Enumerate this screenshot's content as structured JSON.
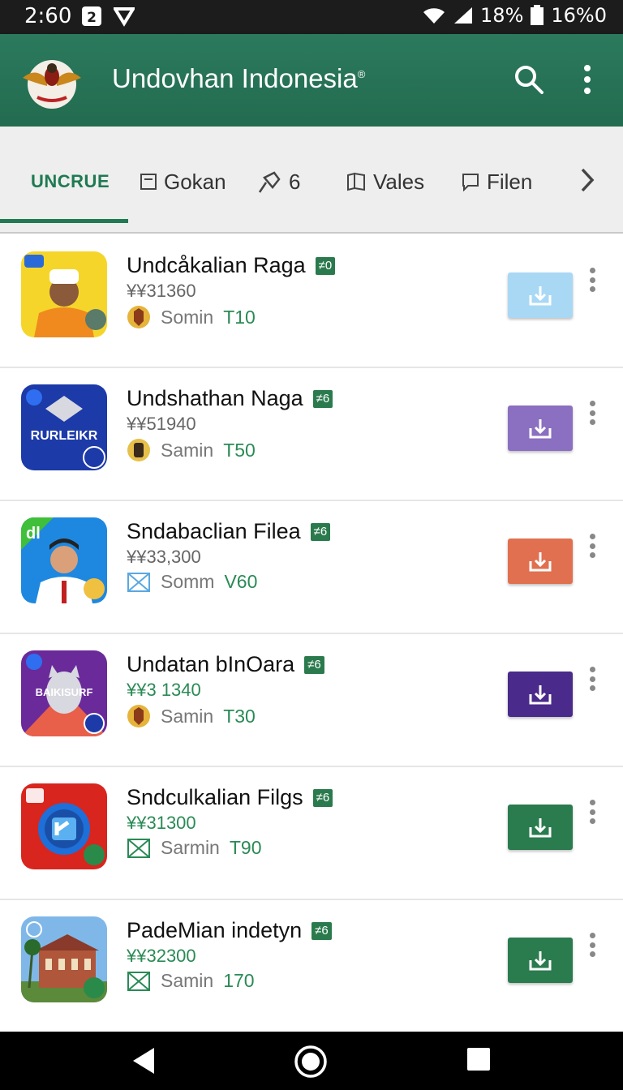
{
  "status_bar": {
    "time": "2:60",
    "signal_percent": "18%",
    "battery": "16%0"
  },
  "app_bar": {
    "title": "Undovhan Indonesia",
    "title_mark": "®"
  },
  "tabs": [
    {
      "label": "UNCRUE",
      "active": true
    },
    {
      "label": "Gokan",
      "icon": "card-icon"
    },
    {
      "label": "6",
      "icon": "pin-icon"
    },
    {
      "label": "Vales",
      "icon": "book-icon"
    },
    {
      "label": "Filen",
      "icon": "chat-icon"
    }
  ],
  "apps": [
    {
      "title": "Undcåkalian Raga",
      "badge": "≠0",
      "price": "¥¥31360",
      "meta_label": "Somin",
      "meta_code": "T10",
      "button_color": "#a9d8f5",
      "icon_theme": "yellow-portrait"
    },
    {
      "title": "Undshathan Naga",
      "badge": "≠6",
      "price": "¥¥51940",
      "meta_label": "Samin",
      "meta_code": "T50",
      "button_color": "#8b6fc0",
      "icon_theme": "blue-badge",
      "icon_text": "RURLEIKR"
    },
    {
      "title": "Sndabaclian Filea",
      "badge": "≠6",
      "price": "¥¥33,300",
      "meta_label": "Somm",
      "meta_code": "V60",
      "button_color": "#e07050",
      "icon_theme": "green-portrait",
      "icon_text": "dl"
    },
    {
      "title": "Undatan bInOara",
      "badge": "≠6",
      "price": "¥¥3 1340",
      "meta_label": "Samin",
      "meta_code": "T30",
      "button_color": "#4a2a8a",
      "icon_theme": "purple-cat",
      "icon_text": "BAIKISURF"
    },
    {
      "title": "Sndculkalian Filgs",
      "badge": "≠6",
      "price": "¥¥31300",
      "meta_label": "Sarmin",
      "meta_code": "T90",
      "button_color": "#2a7b4e",
      "icon_theme": "red-camera"
    },
    {
      "title": "PadeMian indetyn",
      "badge": "≠6",
      "price": "¥¥32300",
      "meta_label": "Samin",
      "meta_code": "170",
      "button_color": "#2a7b4e",
      "icon_theme": "building"
    }
  ]
}
